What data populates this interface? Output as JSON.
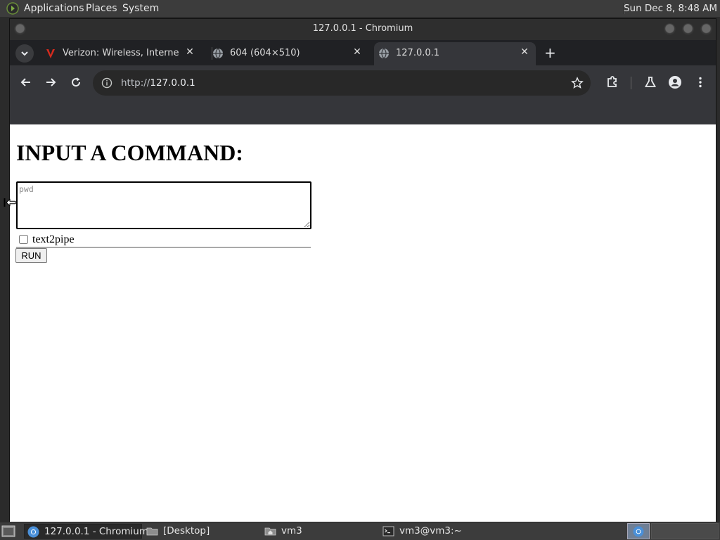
{
  "top_panel": {
    "menus": [
      "Applications",
      "Places",
      "System"
    ],
    "clock": "Sun Dec  8,  8:48 AM"
  },
  "window": {
    "title": "127.0.0.1 - Chromium"
  },
  "tabs": [
    {
      "title": "Verizon: Wireless, Internet, T",
      "favicon": "verizon-logo-icon",
      "active": false
    },
    {
      "title": "604 (604×510)",
      "favicon": "globe-icon",
      "active": false
    },
    {
      "title": "127.0.0.1",
      "favicon": "globe-icon",
      "active": true
    }
  ],
  "toolbar": {
    "url_scheme": "http://",
    "url_host": "127.0.0.1"
  },
  "page": {
    "heading": "INPUT A COMMAND:",
    "textarea_placeholder": "pwd",
    "textarea_value": "",
    "checkbox_label": "text2pipe",
    "checkbox_checked": false,
    "run_label": "RUN"
  },
  "taskbar": {
    "items": [
      {
        "label": "127.0.0.1 - Chromium",
        "icon": "chromium-icon",
        "active": true
      },
      {
        "label": "[Desktop]",
        "icon": "folder-icon",
        "active": false
      },
      {
        "label": "vm3",
        "icon": "folder-home-icon",
        "active": false
      },
      {
        "label": "vm3@vm3:~",
        "icon": "terminal-icon",
        "active": false
      }
    ]
  },
  "colors": {
    "panel_bg": "#3c3c3c",
    "browser_chrome": "#35363a",
    "tabstrip_bg": "#202124",
    "page_bg": "#ffffff"
  }
}
